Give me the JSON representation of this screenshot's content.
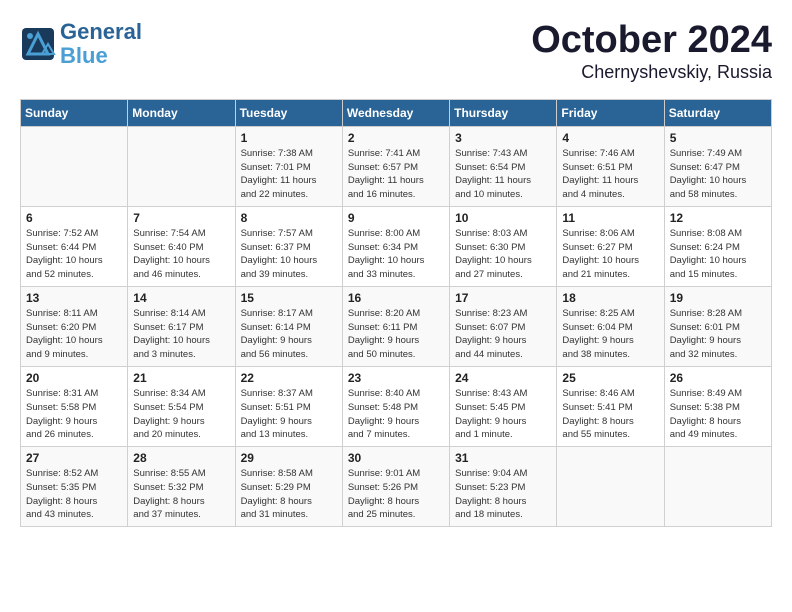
{
  "header": {
    "logo_line1": "General",
    "logo_line2": "Blue",
    "title": "October 2024",
    "subtitle": "Chernyshevskiy, Russia"
  },
  "calendar": {
    "days_of_week": [
      "Sunday",
      "Monday",
      "Tuesday",
      "Wednesday",
      "Thursday",
      "Friday",
      "Saturday"
    ],
    "weeks": [
      [
        {
          "day": "",
          "info": ""
        },
        {
          "day": "",
          "info": ""
        },
        {
          "day": "1",
          "info": "Sunrise: 7:38 AM\nSunset: 7:01 PM\nDaylight: 11 hours\nand 22 minutes."
        },
        {
          "day": "2",
          "info": "Sunrise: 7:41 AM\nSunset: 6:57 PM\nDaylight: 11 hours\nand 16 minutes."
        },
        {
          "day": "3",
          "info": "Sunrise: 7:43 AM\nSunset: 6:54 PM\nDaylight: 11 hours\nand 10 minutes."
        },
        {
          "day": "4",
          "info": "Sunrise: 7:46 AM\nSunset: 6:51 PM\nDaylight: 11 hours\nand 4 minutes."
        },
        {
          "day": "5",
          "info": "Sunrise: 7:49 AM\nSunset: 6:47 PM\nDaylight: 10 hours\nand 58 minutes."
        }
      ],
      [
        {
          "day": "6",
          "info": "Sunrise: 7:52 AM\nSunset: 6:44 PM\nDaylight: 10 hours\nand 52 minutes."
        },
        {
          "day": "7",
          "info": "Sunrise: 7:54 AM\nSunset: 6:40 PM\nDaylight: 10 hours\nand 46 minutes."
        },
        {
          "day": "8",
          "info": "Sunrise: 7:57 AM\nSunset: 6:37 PM\nDaylight: 10 hours\nand 39 minutes."
        },
        {
          "day": "9",
          "info": "Sunrise: 8:00 AM\nSunset: 6:34 PM\nDaylight: 10 hours\nand 33 minutes."
        },
        {
          "day": "10",
          "info": "Sunrise: 8:03 AM\nSunset: 6:30 PM\nDaylight: 10 hours\nand 27 minutes."
        },
        {
          "day": "11",
          "info": "Sunrise: 8:06 AM\nSunset: 6:27 PM\nDaylight: 10 hours\nand 21 minutes."
        },
        {
          "day": "12",
          "info": "Sunrise: 8:08 AM\nSunset: 6:24 PM\nDaylight: 10 hours\nand 15 minutes."
        }
      ],
      [
        {
          "day": "13",
          "info": "Sunrise: 8:11 AM\nSunset: 6:20 PM\nDaylight: 10 hours\nand 9 minutes."
        },
        {
          "day": "14",
          "info": "Sunrise: 8:14 AM\nSunset: 6:17 PM\nDaylight: 10 hours\nand 3 minutes."
        },
        {
          "day": "15",
          "info": "Sunrise: 8:17 AM\nSunset: 6:14 PM\nDaylight: 9 hours\nand 56 minutes."
        },
        {
          "day": "16",
          "info": "Sunrise: 8:20 AM\nSunset: 6:11 PM\nDaylight: 9 hours\nand 50 minutes."
        },
        {
          "day": "17",
          "info": "Sunrise: 8:23 AM\nSunset: 6:07 PM\nDaylight: 9 hours\nand 44 minutes."
        },
        {
          "day": "18",
          "info": "Sunrise: 8:25 AM\nSunset: 6:04 PM\nDaylight: 9 hours\nand 38 minutes."
        },
        {
          "day": "19",
          "info": "Sunrise: 8:28 AM\nSunset: 6:01 PM\nDaylight: 9 hours\nand 32 minutes."
        }
      ],
      [
        {
          "day": "20",
          "info": "Sunrise: 8:31 AM\nSunset: 5:58 PM\nDaylight: 9 hours\nand 26 minutes."
        },
        {
          "day": "21",
          "info": "Sunrise: 8:34 AM\nSunset: 5:54 PM\nDaylight: 9 hours\nand 20 minutes."
        },
        {
          "day": "22",
          "info": "Sunrise: 8:37 AM\nSunset: 5:51 PM\nDaylight: 9 hours\nand 13 minutes."
        },
        {
          "day": "23",
          "info": "Sunrise: 8:40 AM\nSunset: 5:48 PM\nDaylight: 9 hours\nand 7 minutes."
        },
        {
          "day": "24",
          "info": "Sunrise: 8:43 AM\nSunset: 5:45 PM\nDaylight: 9 hours\nand 1 minute."
        },
        {
          "day": "25",
          "info": "Sunrise: 8:46 AM\nSunset: 5:41 PM\nDaylight: 8 hours\nand 55 minutes."
        },
        {
          "day": "26",
          "info": "Sunrise: 8:49 AM\nSunset: 5:38 PM\nDaylight: 8 hours\nand 49 minutes."
        }
      ],
      [
        {
          "day": "27",
          "info": "Sunrise: 8:52 AM\nSunset: 5:35 PM\nDaylight: 8 hours\nand 43 minutes."
        },
        {
          "day": "28",
          "info": "Sunrise: 8:55 AM\nSunset: 5:32 PM\nDaylight: 8 hours\nand 37 minutes."
        },
        {
          "day": "29",
          "info": "Sunrise: 8:58 AM\nSunset: 5:29 PM\nDaylight: 8 hours\nand 31 minutes."
        },
        {
          "day": "30",
          "info": "Sunrise: 9:01 AM\nSunset: 5:26 PM\nDaylight: 8 hours\nand 25 minutes."
        },
        {
          "day": "31",
          "info": "Sunrise: 9:04 AM\nSunset: 5:23 PM\nDaylight: 8 hours\nand 18 minutes."
        },
        {
          "day": "",
          "info": ""
        },
        {
          "day": "",
          "info": ""
        }
      ]
    ]
  }
}
